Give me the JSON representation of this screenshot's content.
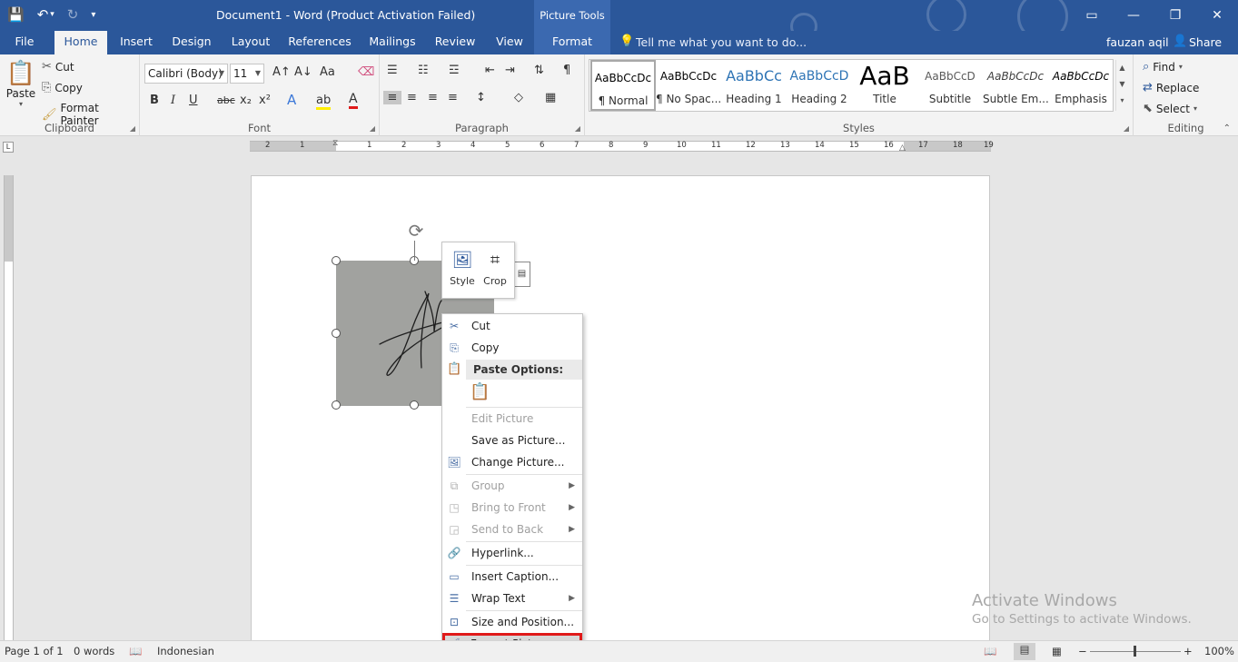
{
  "titlebar": {
    "title": "Document1 - Word (Product Activation Failed)",
    "contextual_tab_group": "Picture Tools",
    "qat": {
      "save": "💾",
      "undo": "↶",
      "undo_arrow": "▾",
      "redo": "↻",
      "customize": "▾"
    },
    "controls": {
      "restore_ribbon": "▭",
      "minimize": "—",
      "maximize": "❐",
      "close": "✕"
    }
  },
  "tabs": [
    "File",
    "Home",
    "Insert",
    "Design",
    "Layout",
    "References",
    "Mailings",
    "Review",
    "View",
    "Format"
  ],
  "tellme": "Tell me what you want to do...",
  "user": "fauzan aqil",
  "share": "Share",
  "clipboard": {
    "label": "Clipboard",
    "paste": "Paste",
    "cut": "Cut",
    "copy": "Copy",
    "format_painter": "Format Painter"
  },
  "font": {
    "label": "Font",
    "name": "Calibri (Body)",
    "size": "11",
    "buttons": {
      "grow": "A↑",
      "shrink": "A↓",
      "case": "Aa",
      "clear": "⌫",
      "bold": "B",
      "italic": "I",
      "underline": "U",
      "strike": "abc",
      "sub": "x₂",
      "sup": "x²",
      "effects": "A",
      "highlight": "ab",
      "color": "A"
    }
  },
  "paragraph": {
    "label": "Paragraph",
    "buttons": {
      "bullets": "☰",
      "numbering": "☷",
      "multilevel": "☲",
      "decrease_indent": "⇤",
      "increase_indent": "⇥",
      "sort": "⇅",
      "pilcrow": "¶",
      "align_left": "≡",
      "center": "≡",
      "align_right": "≡",
      "justify": "≡",
      "line_spacing": "↕",
      "shading": "◇",
      "borders": "▦"
    }
  },
  "styles": {
    "label": "Styles",
    "items": [
      {
        "sample": "AaBbCcDc",
        "name": "¶ Normal"
      },
      {
        "sample": "AaBbCcDc",
        "name": "¶ No Spac..."
      },
      {
        "sample": "AaBbCc",
        "name": "Heading 1"
      },
      {
        "sample": "AaBbCcD",
        "name": "Heading 2"
      },
      {
        "sample": "AaB",
        "name": "Title"
      },
      {
        "sample": "AaBbCcD",
        "name": "Subtitle"
      },
      {
        "sample": "AaBbCcDc",
        "name": "Subtle Em..."
      },
      {
        "sample": "AaBbCcDc",
        "name": "Emphasis"
      }
    ]
  },
  "editing": {
    "label": "Editing",
    "find": "Find",
    "replace": "Replace",
    "select": "Select"
  },
  "ruler": {
    "corner": "L",
    "numbers": [
      "2",
      "1",
      "1",
      "2",
      "3",
      "4",
      "5",
      "6",
      "7",
      "8",
      "9",
      "10",
      "11",
      "12",
      "13",
      "14",
      "15",
      "16",
      "17",
      "18",
      "19"
    ]
  },
  "minitoolbar": {
    "style": "Style",
    "crop": "Crop"
  },
  "context_menu": {
    "cut": "Cut",
    "copy": "Copy",
    "paste_options": "Paste Options:",
    "edit_picture": "Edit Picture",
    "save_as_picture": "Save as Picture...",
    "change_picture": "Change Picture...",
    "group": "Group",
    "bring_to_front": "Bring to Front",
    "send_to_back": "Send to Back",
    "hyperlink": "Hyperlink...",
    "insert_caption": "Insert Caption...",
    "wrap_text": "Wrap Text",
    "size_and_position": "Size and Position...",
    "format_picture": "Format Picture..."
  },
  "watermark": {
    "line1": "Activate Windows",
    "line2": "Go to Settings to activate Windows."
  },
  "status": {
    "page": "Page 1 of 1",
    "words": "0 words",
    "language": "Indonesian",
    "zoom": "100%",
    "zoom_minus": "−",
    "zoom_plus": "+"
  },
  "colors": {
    "accent": "#2b579a",
    "highlight_red": "#e01a1a"
  }
}
